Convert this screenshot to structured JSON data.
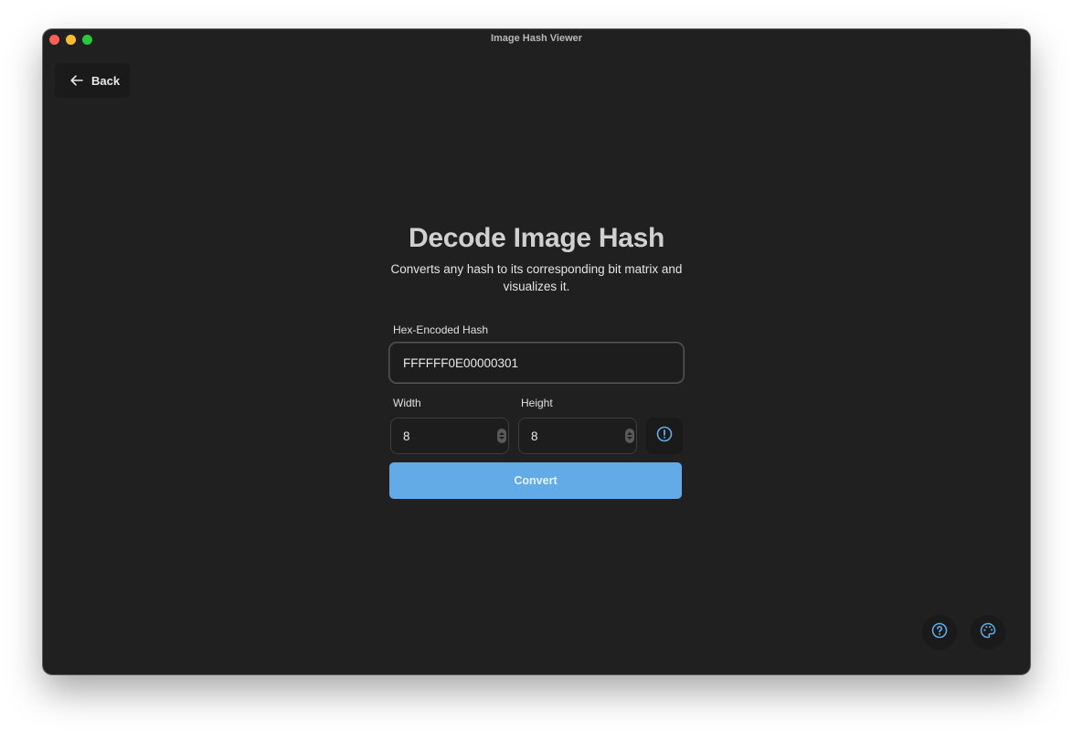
{
  "window": {
    "title": "Image Hash Viewer"
  },
  "nav": {
    "back_label": "Back"
  },
  "decoder": {
    "heading": "Decode Image Hash",
    "subtitle_line1": "Converts any hash to its corresponding bit matrix and",
    "subtitle_line2": "visualizes it.",
    "hash_label": "Hex-Encoded Hash",
    "hash_value": "FFFFFF0E00000301",
    "width_label": "Width",
    "width_value": "8",
    "height_label": "Height",
    "height_value": "8",
    "convert_label": "Convert"
  },
  "icons": {
    "back": "arrow-left-icon",
    "info": "alert-circle-icon",
    "help": "question-circle-icon",
    "theme": "palette-icon"
  },
  "colors": {
    "accent": "#63abe6",
    "background": "#202020"
  }
}
